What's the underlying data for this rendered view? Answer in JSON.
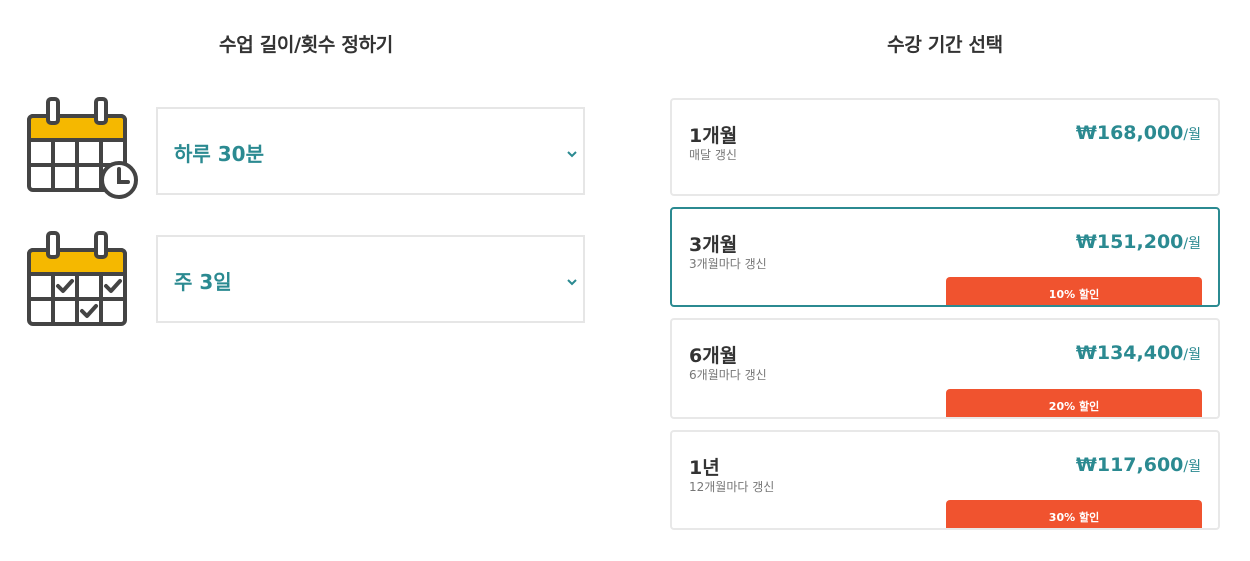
{
  "lesson": {
    "title": "수업 길이/횟수 정하기",
    "duration": {
      "value": "하루 30분",
      "icon": "calendar-clock-icon"
    },
    "frequency": {
      "value": "주 3일",
      "icon": "calendar-check-icon"
    },
    "chevron_icon": "chevron-down-icon"
  },
  "plans": {
    "title": "수강 기간 선택",
    "price_unit": "/월",
    "items": [
      {
        "name": "1개월",
        "renewal": "매달 갱신",
        "price": "₩168,000",
        "discount": "",
        "selected": false
      },
      {
        "name": "3개월",
        "renewal": "3개월마다 갱신",
        "price": "₩151,200",
        "discount": "10% 할인",
        "selected": true
      },
      {
        "name": "6개월",
        "renewal": "6개월마다 갱신",
        "price": "₩134,400",
        "discount": "20% 할인",
        "selected": false
      },
      {
        "name": "1년",
        "renewal": "12개월마다 갱신",
        "price": "₩117,600",
        "discount": "30% 할인",
        "selected": false
      }
    ]
  },
  "colors": {
    "accent": "#2b8a91",
    "badge": "#f0532f",
    "calendar_header": "#f5b800",
    "icon_stroke": "#444444"
  }
}
